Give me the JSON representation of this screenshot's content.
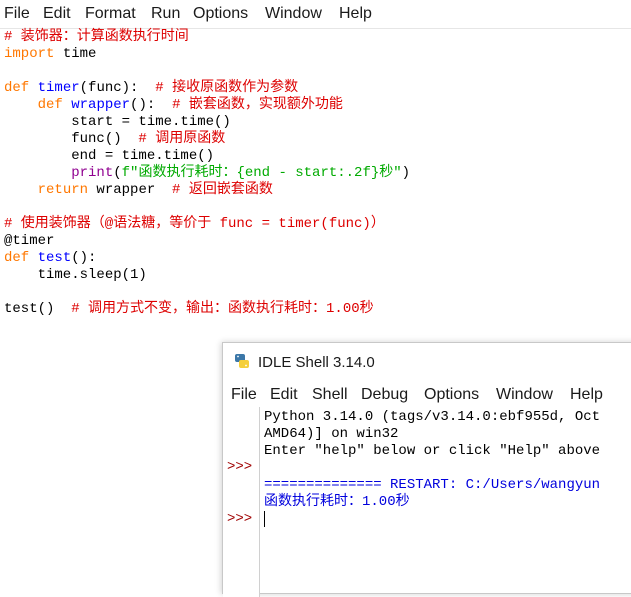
{
  "editor": {
    "menu": [
      "File",
      "Edit",
      "Format",
      "Run",
      "Options",
      "Window",
      "Help"
    ],
    "lines": [
      [
        {
          "t": "# 装饰器：计算函数执行时间",
          "c": "comment"
        }
      ],
      [
        {
          "t": "import",
          "c": "kw"
        },
        {
          "t": " time",
          "c": "plain"
        }
      ],
      [],
      [
        {
          "t": "def",
          "c": "kw"
        },
        {
          "t": " ",
          "c": "plain"
        },
        {
          "t": "timer",
          "c": "def"
        },
        {
          "t": "(func):  ",
          "c": "plain"
        },
        {
          "t": "# 接收原函数作为参数",
          "c": "comment"
        }
      ],
      [
        {
          "t": "    ",
          "c": "plain"
        },
        {
          "t": "def",
          "c": "kw"
        },
        {
          "t": " ",
          "c": "plain"
        },
        {
          "t": "wrapper",
          "c": "def"
        },
        {
          "t": "():  ",
          "c": "plain"
        },
        {
          "t": "# 嵌套函数，实现额外功能",
          "c": "comment"
        }
      ],
      [
        {
          "t": "        start = time.time()",
          "c": "plain"
        }
      ],
      [
        {
          "t": "        func()  ",
          "c": "plain"
        },
        {
          "t": "# 调用原函数",
          "c": "comment"
        }
      ],
      [
        {
          "t": "        end = time.time()",
          "c": "plain"
        }
      ],
      [
        {
          "t": "        ",
          "c": "plain"
        },
        {
          "t": "print",
          "c": "builtin"
        },
        {
          "t": "(",
          "c": "plain"
        },
        {
          "t": "f\"函数执行耗时：{end - start:.2f}秒\"",
          "c": "string"
        },
        {
          "t": ")",
          "c": "plain"
        }
      ],
      [
        {
          "t": "    ",
          "c": "plain"
        },
        {
          "t": "return",
          "c": "kw"
        },
        {
          "t": " wrapper  ",
          "c": "plain"
        },
        {
          "t": "# 返回嵌套函数",
          "c": "comment"
        }
      ],
      [],
      [
        {
          "t": "# 使用装饰器（@语法糖，等价于 func = timer(func)）",
          "c": "comment"
        }
      ],
      [
        {
          "t": "@timer",
          "c": "plain"
        }
      ],
      [
        {
          "t": "def",
          "c": "kw"
        },
        {
          "t": " ",
          "c": "plain"
        },
        {
          "t": "test",
          "c": "def"
        },
        {
          "t": "():",
          "c": "plain"
        }
      ],
      [
        {
          "t": "    time.sleep(1)",
          "c": "plain"
        }
      ],
      [],
      [
        {
          "t": "test()  ",
          "c": "plain"
        },
        {
          "t": "# 调用方式不变，输出：函数执行耗时：1.00秒",
          "c": "comment"
        }
      ]
    ]
  },
  "shell": {
    "title": "IDLE Shell 3.14.0",
    "menu": [
      "File",
      "Edit",
      "Shell",
      "Debug",
      "Options",
      "Window",
      "Help"
    ],
    "prompt": ">>>",
    "output": {
      "line1": "Python 3.14.0 (tags/v3.14.0:ebf955d, Oct",
      "line2": "AMD64)] on win32",
      "line3": "Enter \"help\" below or click \"Help\" above",
      "line4": "",
      "restart": "============== RESTART: C:/Users/wangyun",
      "result": "函数执行耗时：1.00秒"
    }
  },
  "colors": {
    "comment": "#dd0000",
    "keyword": "#ff7700",
    "definition": "#0000ff",
    "builtin": "#900090",
    "string": "#00aa00"
  }
}
